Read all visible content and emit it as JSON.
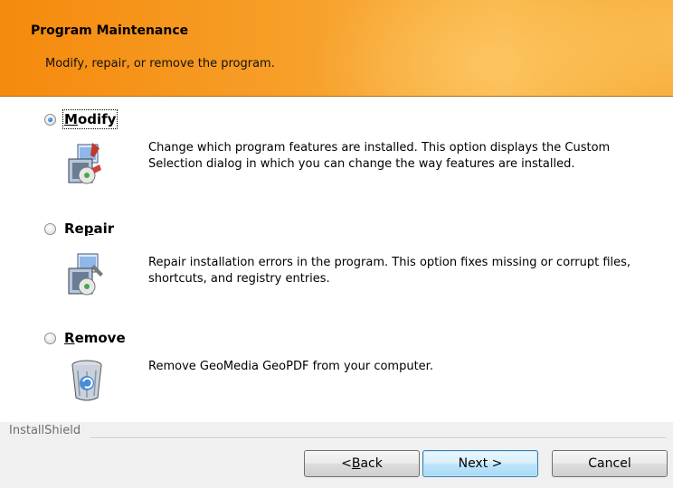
{
  "banner": {
    "title": "Program Maintenance",
    "subtitle": "Modify, repair, or remove the program.",
    "colors": {
      "start": "#f58a0d",
      "end": "#f9b545"
    }
  },
  "options": [
    {
      "label_pre": "",
      "label_ul": "M",
      "label_post": "odify",
      "selected": true,
      "description": "Change which program features are installed. This option displays the Custom Selection dialog in which you can change the way features are installed.",
      "icon": "modify-setup-icon"
    },
    {
      "label_pre": "Re",
      "label_ul": "p",
      "label_post": "air",
      "selected": false,
      "description": "Repair installation errors in the program. This option fixes missing or corrupt files, shortcuts, and registry entries.",
      "icon": "repair-setup-icon"
    },
    {
      "label_pre": "",
      "label_ul": "R",
      "label_post": "emove",
      "selected": false,
      "description": "Remove  GeoMedia GeoPDF from your computer.",
      "icon": "recycle-bin-icon"
    }
  ],
  "footer": {
    "brand": "InstallShield",
    "back": {
      "pre": "< ",
      "ul": "B",
      "post": "ack"
    },
    "next": "Next >",
    "cancel": "Cancel"
  }
}
